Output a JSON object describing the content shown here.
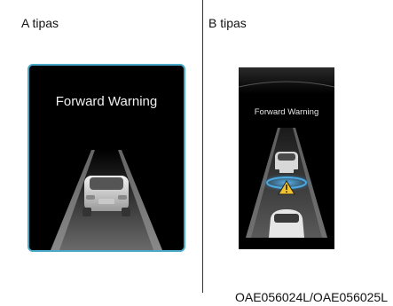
{
  "panels": [
    {
      "label": "A tipas",
      "display_text": "Forward Warning"
    },
    {
      "label": "B tipas",
      "display_text": "Forward Warning"
    }
  ],
  "caption": "OAE056024L/OAE056025L",
  "colors": {
    "frame_border": "#4aa8c8",
    "screen_bg": "#000000",
    "warning_blue": "#2f8fd8",
    "warning_yellow": "#f2c230"
  },
  "icons": {
    "panel_a": "car-rear-icon",
    "panel_b_lead": "car-rear-icon",
    "panel_b_own": "car-front-icon",
    "panel_b_warning": "warning-triangle-icon"
  }
}
